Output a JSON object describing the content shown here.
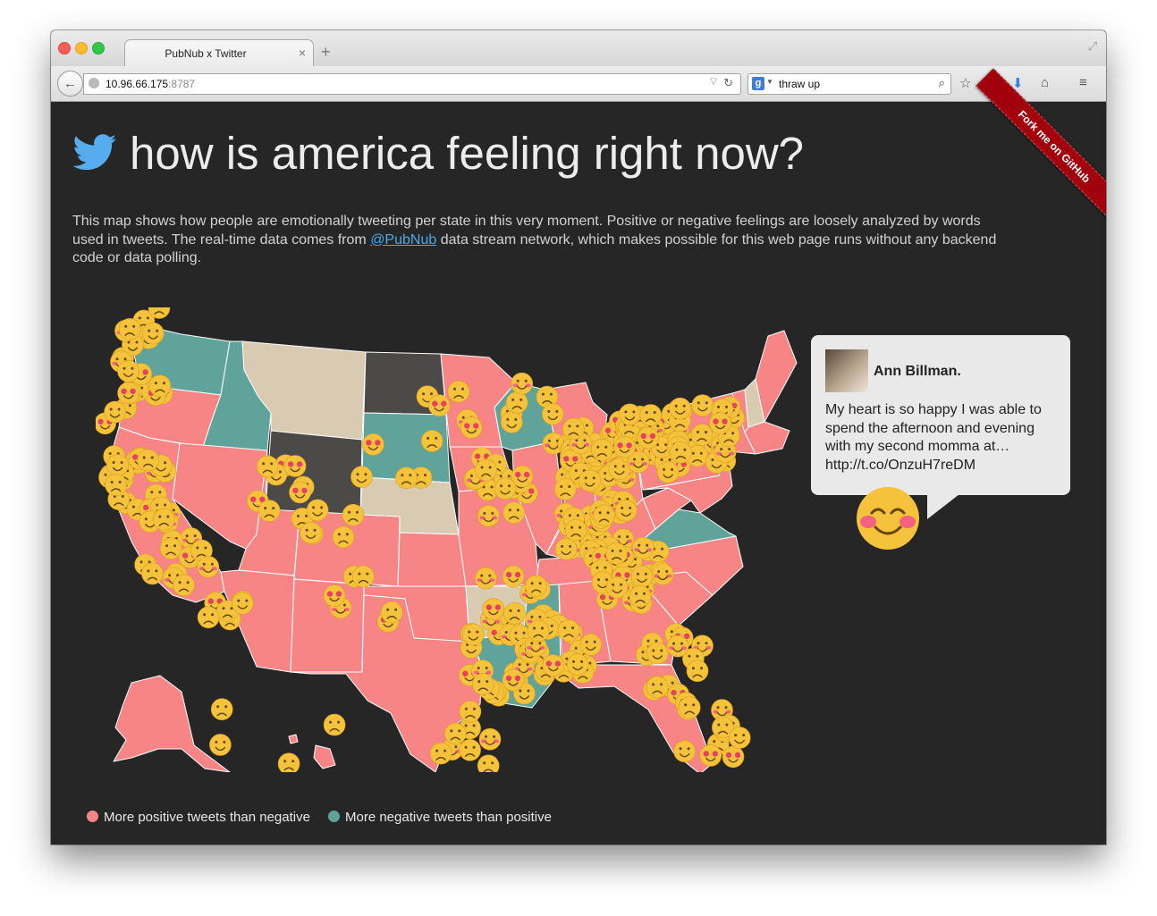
{
  "browser": {
    "tab_title": "PubNub x Twitter",
    "tab_close": "×",
    "new_tab": "+",
    "url_host": "10.96.66.175",
    "url_port": ":8787",
    "search_engine": "g",
    "search_query": "thraw up"
  },
  "page": {
    "title": "how is america feeling right now?",
    "description_before_link": "This map shows how people are emotionally tweeting per state in this very moment. Positive or negative feelings are loosely analyzed by words used in tweets. The real-time data comes from ",
    "description_link": "@PubNub",
    "description_after_link": " data stream network, which makes possible for this web page runs without any backend code or data polling.",
    "ribbon": "Fork me on GitHub"
  },
  "tweet": {
    "username": "Ann Billman.",
    "text": "My heart is so happy I was able to spend the afternoon and evening with my second momma at… http://t.co/OnzuH7reDM"
  },
  "legend": {
    "positive_label": "More positive tweets than negative",
    "negative_label": "More negative tweets than positive"
  },
  "colors": {
    "page_bg": "#262626",
    "positive": "#f78585",
    "negative": "#5fa39a",
    "neutral": "#d9cbb2",
    "nodata": "#4c4949",
    "emoji": "#f5c33b",
    "link": "#4aa8ec",
    "ribbon": "#a3000e"
  }
}
